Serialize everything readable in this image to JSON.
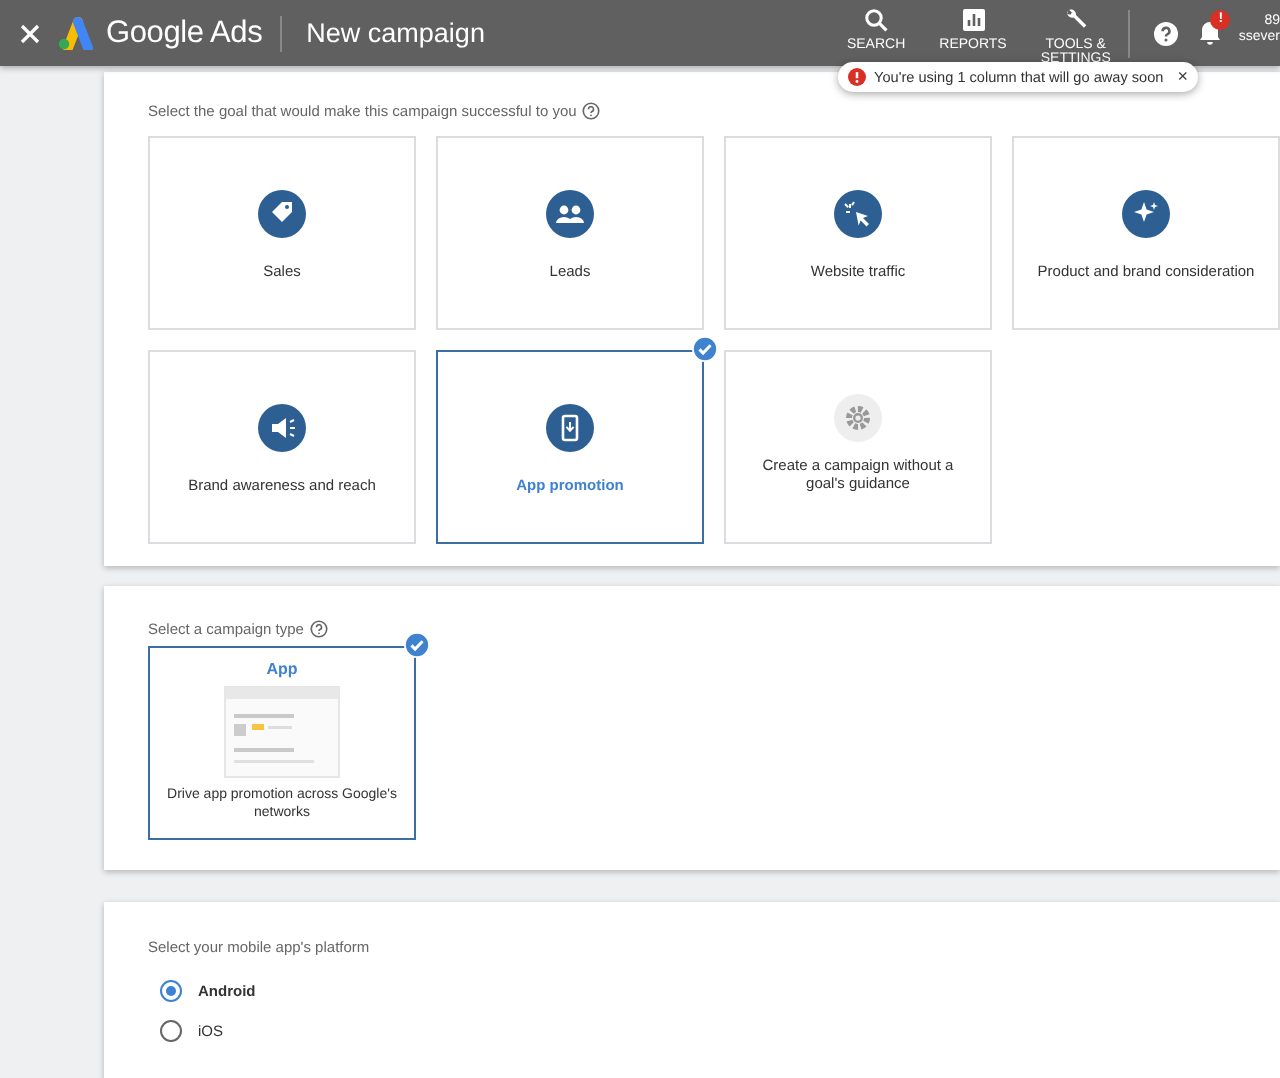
{
  "header": {
    "product": "Google Ads",
    "page_title": "New campaign",
    "nav": [
      {
        "label": "SEARCH"
      },
      {
        "label": "REPORTS"
      },
      {
        "label": "TOOLS &",
        "label_2": "SETTINGS"
      }
    ],
    "notification_badge": "!",
    "account_line_1": "89",
    "account_line_2": "ssever"
  },
  "tooltip": {
    "text": "You're using 1 column that will go away soon",
    "close": "×"
  },
  "goal_section": {
    "prompt": "Select the goal that would make this campaign successful to you",
    "goals": [
      {
        "label": "Sales",
        "selected": false
      },
      {
        "label": "Leads",
        "selected": false
      },
      {
        "label": "Website traffic",
        "selected": false
      },
      {
        "label": "Product and brand consideration",
        "selected": false
      },
      {
        "label": "Brand awareness and reach",
        "selected": false
      },
      {
        "label": "App promotion",
        "selected": true
      },
      {
        "label": "Create a campaign without a goal's guidance",
        "selected": false
      }
    ]
  },
  "type_section": {
    "prompt": "Select a campaign type",
    "types": [
      {
        "title": "App",
        "description": "Drive app promotion across Google's networks",
        "selected": true
      }
    ]
  },
  "platform_section": {
    "prompt": "Select your mobile app's platform",
    "options": [
      {
        "label": "Android",
        "selected": true
      },
      {
        "label": "iOS",
        "selected": false
      }
    ]
  }
}
